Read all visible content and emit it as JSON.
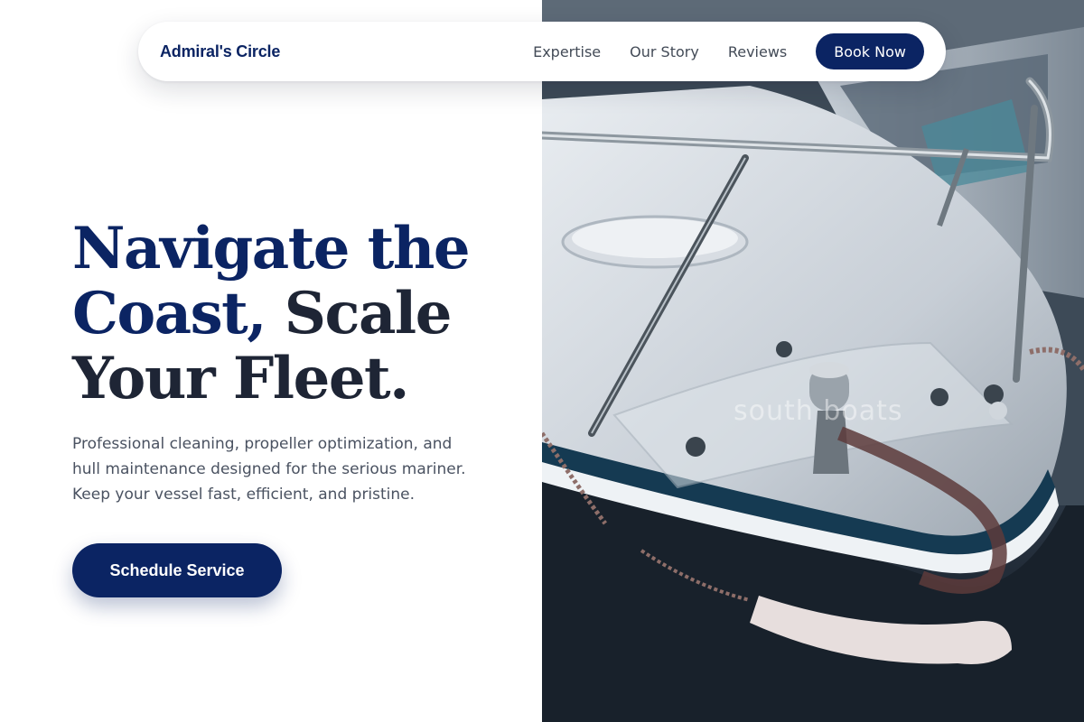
{
  "nav": {
    "brand": "Admiral's Circle",
    "links": [
      "Expertise",
      "Our Story",
      "Reviews"
    ],
    "cta_label": "Book Now"
  },
  "hero": {
    "title_accent_1": "Navigate the",
    "title_accent_2": "Coast,",
    "title_rest_1": "Scale",
    "title_rest_2": "Your Fleet.",
    "subtitle": "Professional cleaning, propeller optimization, and hull maintenance designed for the serious mariner. Keep your vessel fast, efficient, and pristine.",
    "cta_label": "Schedule Service",
    "image_watermark": "south boats"
  },
  "colors": {
    "brand_navy": "#0b2463",
    "heading_dark": "#1e2535",
    "body_text": "#4a5261",
    "hull_stripe": "#153a52"
  },
  "icons": {
    "hero_image": "boat-bow-photo"
  }
}
